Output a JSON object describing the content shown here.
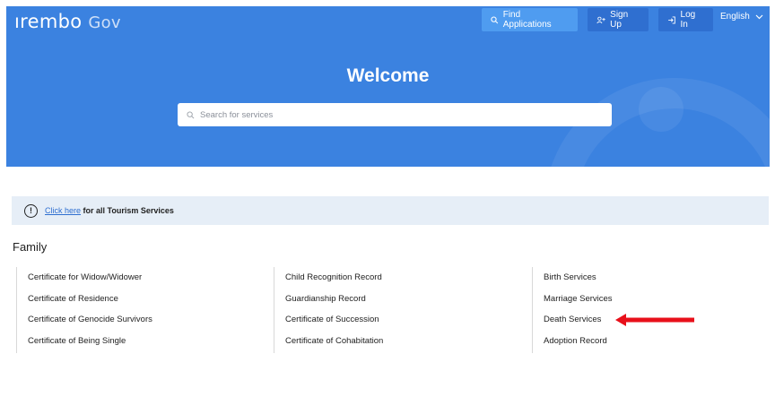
{
  "header": {
    "logo_main": "ırembo",
    "logo_sub": "Gov",
    "find_applications": "Find Applications",
    "sign_up": "Sign Up",
    "log_in": "Log In",
    "language": "English"
  },
  "hero": {
    "title": "Welcome",
    "search_placeholder": "Search for services"
  },
  "notice": {
    "link_text": "Click here",
    "rest_text": "for all Tourism Services"
  },
  "family": {
    "title": "Family",
    "columns": [
      [
        "Certificate for Widow/Widower",
        "Certificate of Residence",
        "Certificate of Genocide Survivors",
        "Certificate of Being Single"
      ],
      [
        "Child Recognition Record",
        "Guardianship Record",
        "Certificate of Succession",
        "Certificate of Cohabitation"
      ],
      [
        "Birth Services",
        "Marriage Services",
        "Death Services",
        "Adoption Record"
      ]
    ]
  },
  "annotation": {
    "arrow_color": "#e8101a"
  }
}
